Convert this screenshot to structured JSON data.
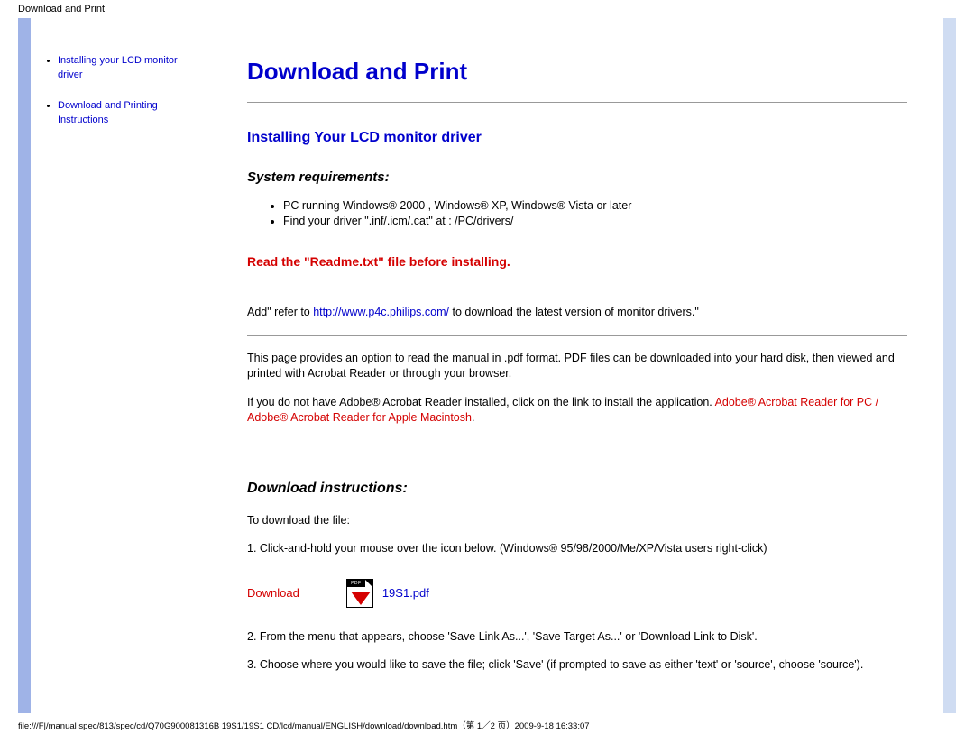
{
  "header": {
    "title": "Download and Print"
  },
  "sidebar": {
    "links": [
      {
        "label": "Installing your LCD monitor driver"
      },
      {
        "label": "Download and Printing Instructions"
      }
    ]
  },
  "main": {
    "title": "Download and Print",
    "section1": {
      "heading": "Installing Your LCD monitor driver",
      "sub": "System requirements:",
      "reqs": [
        "PC running Windows® 2000 , Windows® XP, Windows® Vista or later",
        "Find your driver \".inf/.icm/.cat\" at : /PC/drivers/"
      ],
      "red_note": "Read the \"Readme.txt\" file before installing.",
      "para_add_pre": "Add\" refer to ",
      "para_add_link": "http://www.p4c.philips.com/",
      "para_add_post": " to download the latest version of monitor drivers.\"",
      "para_pdf": "This page provides an option to read the manual in .pdf format. PDF files can be downloaded into your hard disk, then viewed and printed with Acrobat Reader or through your browser.",
      "para_reader_pre": "If you do not have Adobe® Acrobat Reader installed, click on the link to install the application. ",
      "reader_pc": "Adobe® Acrobat Reader for PC",
      "reader_sep": " / ",
      "reader_mac": "Adobe® Acrobat Reader for Apple Macintosh",
      "reader_end": "."
    },
    "section2": {
      "heading": "Download instructions:",
      "p_intro": "To download the file:",
      "step1": "1. Click-and-hold your mouse over the icon below. (Windows® 95/98/2000/Me/XP/Vista users right-click)",
      "dl_label": "Download",
      "dl_file": "19S1.pdf",
      "step2": "2. From the menu that appears, choose 'Save Link As...', 'Save Target As...' or 'Download Link to Disk'.",
      "step3": "3. Choose where you would like to save the file; click 'Save' (if prompted to save as either 'text' or 'source', choose 'source')."
    }
  },
  "footer": {
    "path": "file:///F|/manual spec/813/spec/cd/Q70G900081316B 19S1/19S1 CD/lcd/manual/ENGLISH/download/download.htm（第 1／2 页）2009-9-18 16:33:07"
  }
}
